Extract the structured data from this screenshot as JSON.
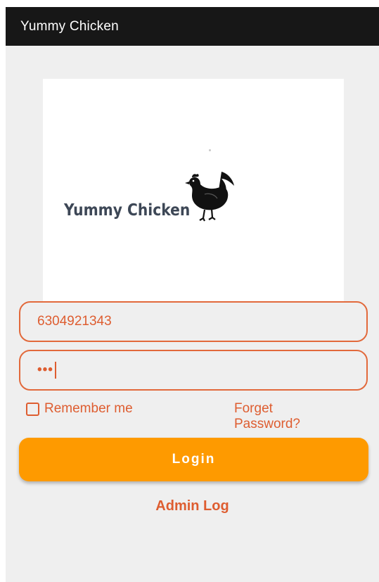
{
  "app_bar": {
    "title": "Yummy Chicken"
  },
  "logo": {
    "text": "Yummy Chicken",
    "icon": "chicken-icon"
  },
  "login_form": {
    "phone_value": "6304921343",
    "password_masked": "•••",
    "remember_label": "Remember me",
    "remember_checked": false,
    "forget_line1": "Forget",
    "forget_line2": "Password?",
    "login_label": "Login",
    "admin_label": "Admin Log"
  },
  "colors": {
    "app_bar_bg": "#171717",
    "accent": "#de5d30",
    "login_button": "#fe9a00",
    "background": "#efefef"
  }
}
